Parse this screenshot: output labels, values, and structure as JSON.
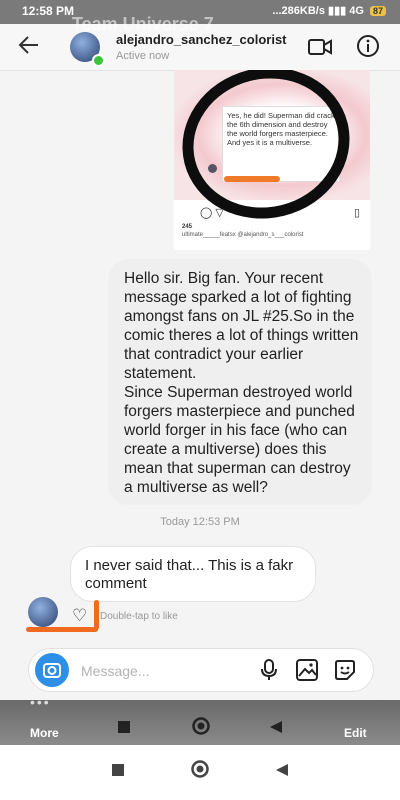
{
  "status_bar": {
    "time": "12:58 PM",
    "network": "...286KB/s",
    "signal": "4G",
    "battery": "87"
  },
  "overlay_title": "Team Universe 7",
  "header": {
    "username": "alejandro_sanchez_colorist",
    "status": "Active now"
  },
  "shared_post": {
    "card_text": "Yes, he did! Superman did crack the 6th dimension and destroy the world forgers masterpiece. And yes it is a multiverse.",
    "likes": "245",
    "caption": "ultimate_____featsx @alejandro_s___colorist"
  },
  "messages": [
    {
      "side": "right",
      "text": "Hello sir. Big fan. Your recent message sparked a lot of fighting amongst fans on JL #25.So in the comic theres a lot of things written that contradict your earlier statement.\nSince Superman destroyed world forgers masterpiece and punched world forger in his face (who can create a  multiverse) does this mean that superman can destroy a multiverse as well?"
    },
    {
      "side": "left",
      "text": "I never said that... This is a fakr comment"
    }
  ],
  "timestamp": "Today 12:53 PM",
  "reaction_hint": "Double-tap to like",
  "composer": {
    "placeholder": "Message..."
  },
  "story_bar": {
    "more_label": "More",
    "edit_label": "Edit"
  },
  "colors": {
    "camera_button": "#2f8fe6",
    "annotation_orange": "#f06a1f",
    "online_dot": "#3bc43b"
  }
}
